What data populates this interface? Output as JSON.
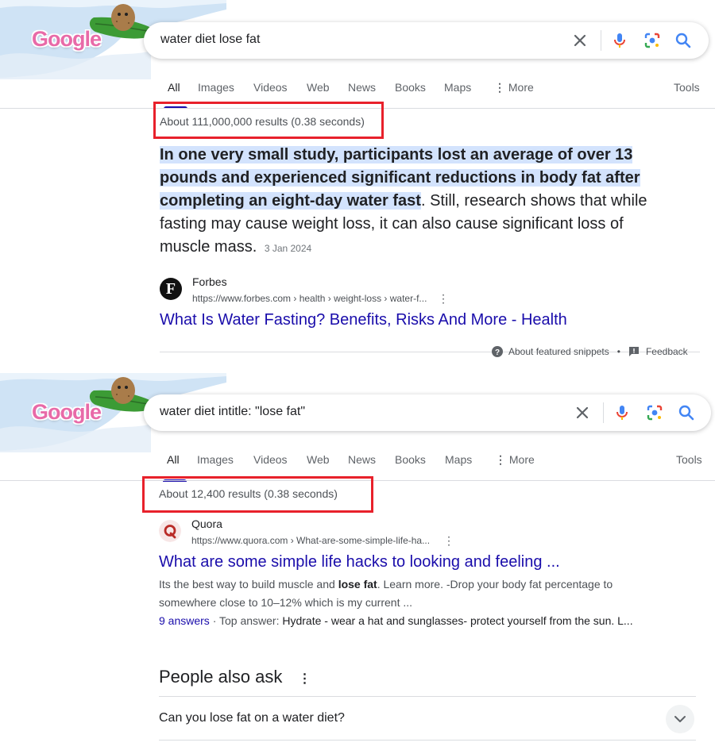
{
  "colors": {
    "accent": "#1a0dab",
    "highlight": "#d3e3fd",
    "red_box": "#e8212b"
  },
  "screen1": {
    "logo_text": "Google",
    "query": "water diet lose fat",
    "tabs": [
      "All",
      "Images",
      "Videos",
      "Web",
      "News",
      "Books",
      "Maps",
      "More",
      "Tools"
    ],
    "stats": "About 111,000,000 results (0.38 seconds)",
    "snippet": {
      "highlighted": "In one very small study, participants lost an average of over 13 pounds and experienced significant reductions in body fat after completing an eight-day water fast",
      "rest": ". Still, research shows that while fasting may cause weight loss, it can also cause significant loss of muscle mass.",
      "date": "3 Jan 2024"
    },
    "result": {
      "favicon_letter": "F",
      "site": "Forbes",
      "url": "https://www.forbes.com › health › weight-loss › water-f...",
      "title": "What Is Water Fasting? Benefits, Risks And More - Health"
    },
    "footer": {
      "about": "About featured snippets",
      "sep": "•",
      "feedback": "Feedback"
    }
  },
  "screen2": {
    "logo_text": "Google",
    "query": "water diet intitle: \"lose fat\"",
    "tabs": [
      "All",
      "Images",
      "Videos",
      "Web",
      "News",
      "Books",
      "Maps",
      "More",
      "Tools"
    ],
    "stats": "About 12,400 results (0.38 seconds)",
    "result": {
      "site": "Quora",
      "url": "https://www.quora.com › What-are-some-simple-life-ha...",
      "title": "What are some simple life hacks to looking and feeling ...",
      "desc_a": "Its the best way to build muscle and ",
      "desc_bold": "lose fat",
      "desc_b": ". Learn more. -Drop your body fat percentage to somewhere close to 10–12% which is my current ...",
      "answers": "9 answers",
      "answer_sep": " · Top answer: ",
      "answer_text": "Hydrate - wear a hat and sunglasses- protect yourself from the sun. L..."
    },
    "paa": {
      "title": "People also ask",
      "questions": [
        "Can you lose fat on a water diet?"
      ]
    }
  }
}
